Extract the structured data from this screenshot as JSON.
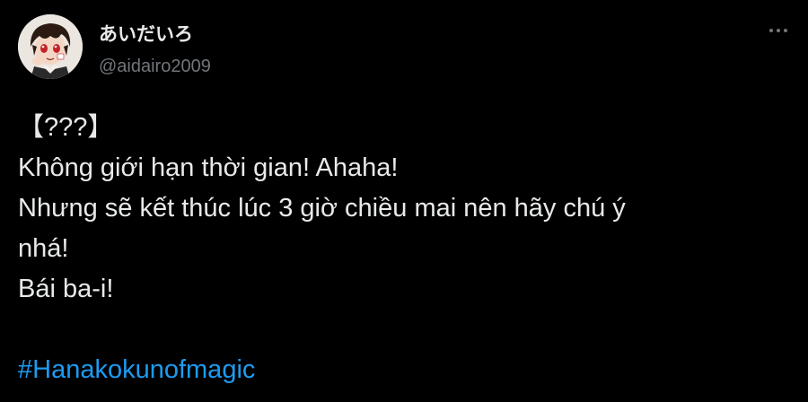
{
  "tweet": {
    "display_name": "あいだいろ",
    "handle": "@aidairo2009",
    "lines": [
      "【???】",
      "Không giới hạn thời gian! Ahaha!",
      "Nhưng sẽ kết thúc lúc 3 giờ chiều mai nên hãy chú ý",
      "nhá!",
      "Bái ba-i!"
    ],
    "hashtag": "#Hanakokunofmagic"
  },
  "icons": {
    "more": "more-horizontal-icon",
    "avatar": "anime-character-avatar"
  },
  "colors": {
    "background": "#000000",
    "text": "#e7e9ea",
    "secondary": "#71767b",
    "link": "#1d9bf0"
  }
}
